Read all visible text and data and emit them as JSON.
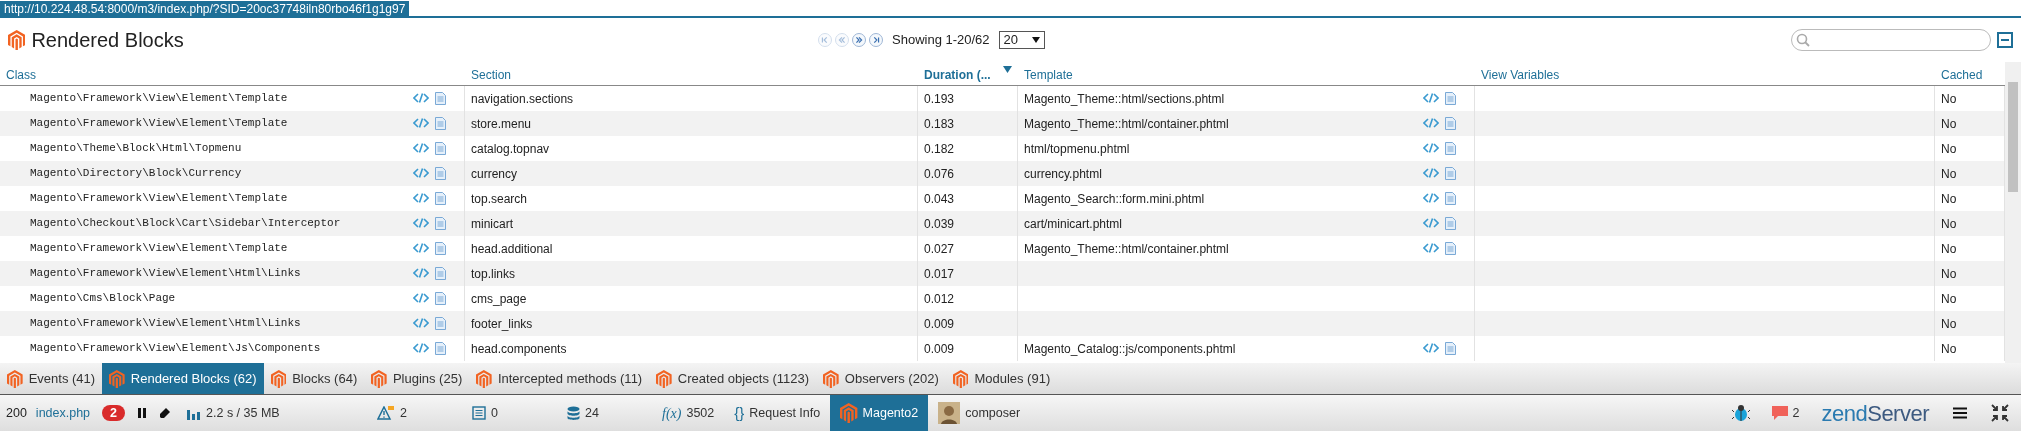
{
  "url": "http://10.224.48.54:8000/m3/index.php/?SID=20oc37748iln80rbo46f1g1g97",
  "header": {
    "title": "Rendered Blocks",
    "pager": [
      {
        "kind": "first",
        "disabled": true
      },
      {
        "kind": "prev",
        "disabled": true
      },
      {
        "kind": "next",
        "disabled": false
      },
      {
        "kind": "last",
        "disabled": false
      }
    ],
    "showing": "Showing 1-20/62",
    "page_size": "20"
  },
  "columns": [
    {
      "label": "Class",
      "sorted": false
    },
    {
      "label": "Section",
      "sorted": false
    },
    {
      "label": "Duration (...",
      "sorted": true
    },
    {
      "label": "Template",
      "sorted": false
    },
    {
      "label": "View Variables",
      "sorted": false
    },
    {
      "label": "Cached",
      "sorted": false
    }
  ],
  "rows": [
    {
      "class": "Magento\\Framework\\View\\Element\\Template",
      "section": "navigation.sections",
      "duration": "0.193",
      "template": "Magento_Theme::html/sections.phtml",
      "cached": "No"
    },
    {
      "class": "Magento\\Framework\\View\\Element\\Template",
      "section": "store.menu",
      "duration": "0.183",
      "template": "Magento_Theme::html/container.phtml",
      "cached": "No"
    },
    {
      "class": "Magento\\Theme\\Block\\Html\\Topmenu",
      "section": "catalog.topnav",
      "duration": "0.182",
      "template": "html/topmenu.phtml",
      "cached": "No"
    },
    {
      "class": "Magento\\Directory\\Block\\Currency",
      "section": "currency",
      "duration": "0.076",
      "template": "currency.phtml",
      "cached": "No"
    },
    {
      "class": "Magento\\Framework\\View\\Element\\Template",
      "section": "top.search",
      "duration": "0.043",
      "template": "Magento_Search::form.mini.phtml",
      "cached": "No"
    },
    {
      "class": "Magento\\Checkout\\Block\\Cart\\Sidebar\\Interceptor",
      "section": "minicart",
      "duration": "0.039",
      "template": "cart/minicart.phtml",
      "cached": "No"
    },
    {
      "class": "Magento\\Framework\\View\\Element\\Template",
      "section": "head.additional",
      "duration": "0.027",
      "template": "Magento_Theme::html/container.phtml",
      "cached": "No"
    },
    {
      "class": "Magento\\Framework\\View\\Element\\Html\\Links",
      "section": "top.links",
      "duration": "0.017",
      "cached": "No"
    },
    {
      "class": "Magento\\Cms\\Block\\Page",
      "section": "cms_page",
      "duration": "0.012",
      "cached": "No"
    },
    {
      "class": "Magento\\Framework\\View\\Element\\Html\\Links",
      "section": "footer_links",
      "duration": "0.009",
      "cached": "No"
    },
    {
      "class": "Magento\\Framework\\View\\Element\\Js\\Components",
      "section": "head.components",
      "duration": "0.009",
      "template": "Magento_Catalog::js/components.phtml",
      "cached": "No"
    }
  ],
  "tabs": [
    {
      "label": "Events (41)",
      "selected": false
    },
    {
      "label": "Rendered Blocks (62)",
      "selected": true
    },
    {
      "label": "Blocks (64)",
      "selected": false
    },
    {
      "label": "Plugins (25)",
      "selected": false
    },
    {
      "label": "Intercepted methods (11)",
      "selected": false
    },
    {
      "label": "Created objects (1123)",
      "selected": false
    },
    {
      "label": "Observers (202)",
      "selected": false
    },
    {
      "label": "Modules (91)",
      "selected": false
    }
  ],
  "status_bar": {
    "left": [
      {
        "kind": "code",
        "text": "200"
      },
      {
        "kind": "link",
        "text": "index.php"
      },
      {
        "kind": "badge",
        "text": "2"
      },
      {
        "kind": "pause"
      },
      {
        "kind": "eraser"
      },
      {
        "kind": "timing",
        "text": "2.2 s / 35 MB"
      },
      {
        "kind": "warnings",
        "text": "2"
      },
      {
        "kind": "logs",
        "text": "0"
      },
      {
        "kind": "queries",
        "text": "24"
      },
      {
        "kind": "functions",
        "glyph": "f(x)",
        "text": "3502"
      },
      {
        "kind": "request",
        "glyph": "{}",
        "text": "Request Info"
      },
      {
        "kind": "magento_tab",
        "text": "Magento2",
        "selected": true
      },
      {
        "kind": "avatar_tab",
        "text": "composer",
        "selected": false
      }
    ],
    "right": [
      {
        "kind": "bug"
      },
      {
        "kind": "messages",
        "text": "2"
      },
      {
        "kind": "brand",
        "text": "zend",
        "text2": "Server"
      },
      {
        "kind": "menu"
      },
      {
        "kind": "collapse"
      }
    ]
  }
}
